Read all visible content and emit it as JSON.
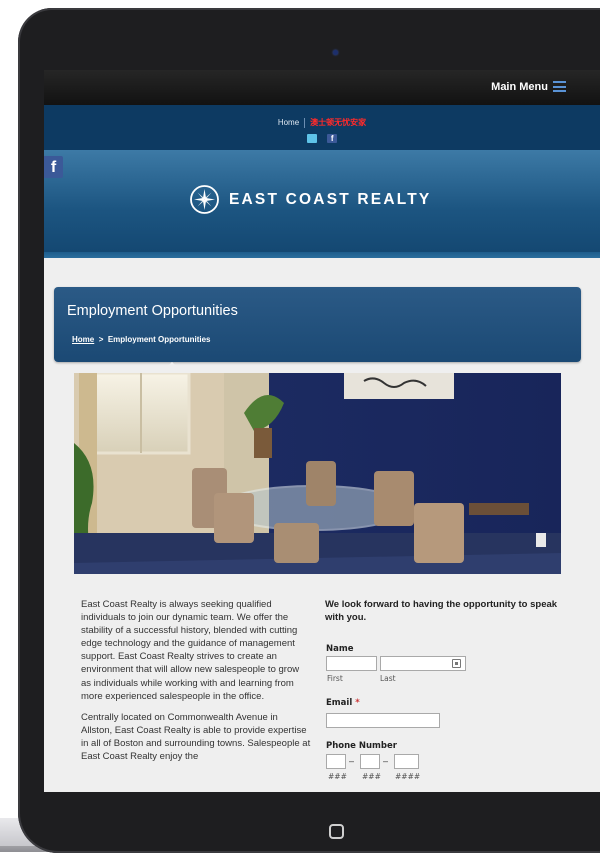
{
  "header": {
    "menu_label": "Main Menu"
  },
  "subnav": {
    "home": "Home",
    "red_link": "澳士顿无忧安家"
  },
  "brand": {
    "name": "EAST COAST REALTY",
    "facebook_glyph": "f",
    "fb_small_glyph": "f"
  },
  "page": {
    "title": "Employment Opportunities",
    "breadcrumb_home": "Home",
    "breadcrumb_sep": ">",
    "breadcrumb_current": "Employment Opportunities"
  },
  "content": {
    "para1": "East Coast Realty is always seeking qualified individuals to join our dynamic team. We offer the stability of a successful history, blended with cutting edge technology and the guidance of management support. East Coast Realty strives to create an environment that will allow new salespeople to grow as individuals while working with and learning from more experienced salespeople in the office.",
    "para2": "Centrally located on Commonwealth Avenue in Allston, East Coast Realty is able to provide expertise in all of Boston and surrounding towns. Salespeople at East Coast Realty enjoy the"
  },
  "form": {
    "intro": "We look forward to having the opportunity to speak with you.",
    "name_label": "Name",
    "first_label": "First",
    "last_label": "Last",
    "email_label": "Email",
    "required_mark": "*",
    "phone_label": "Phone Number",
    "phone_dash": "–",
    "phone_area_hint": "###",
    "phone_prefix_hint": "###",
    "phone_line_hint": "####"
  },
  "colors": {
    "nav_bg": "#0d3a62",
    "banner": "#1c5581",
    "accent_blue": "#5a93d6",
    "red_link": "#ff2a2a",
    "facebook": "#3b5998"
  },
  "icons": [
    "menu-icon",
    "mail-icon",
    "facebook-icon",
    "logo-compass-icon",
    "contact-card-icon",
    "home-button-icon"
  ]
}
